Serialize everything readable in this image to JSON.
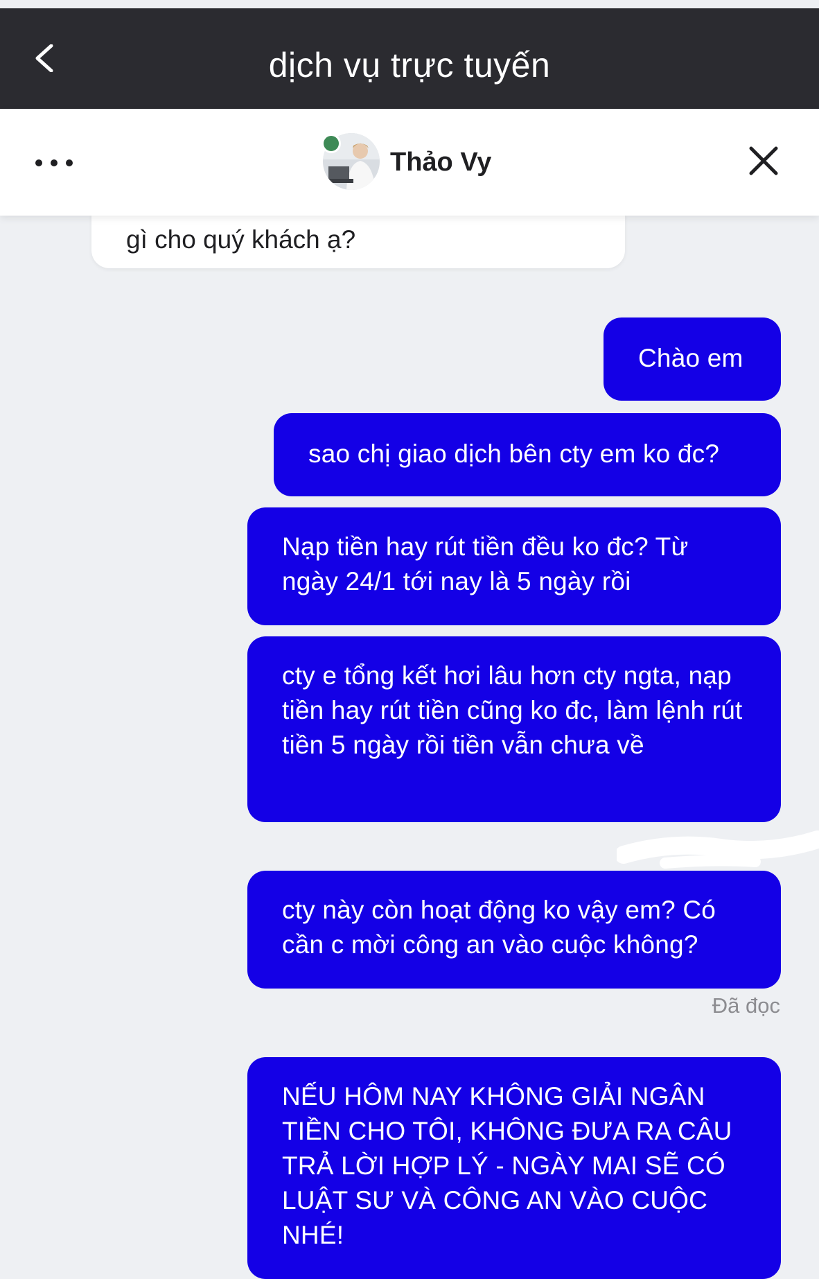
{
  "header": {
    "title": "dịch vụ trực tuyến"
  },
  "chat": {
    "agent_name": "Thảo Vy",
    "status_color": "#3e8a56"
  },
  "messages": {
    "incoming_partial": "gì cho quý khách ạ?",
    "outgoing": [
      "Chào em",
      "sao chị giao dịch bên cty em ko đc?",
      "Nạp tiền hay rút tiền đều ko đc? Từ ngày 24/1 tới nay là 5 ngày rồi",
      "cty e tổng kết hơi lâu hơn cty ngta, nạp tiền hay rút tiền cũng ko đc, làm lệnh rút tiền 5 ngày rồi tiền vẫn chưa về",
      "cty này còn hoạt động ko vậy em? Có cần c mời công an vào cuộc không?",
      "NẾU HÔM NAY KHÔNG GIẢI NGÂN TIỀN CHO TÔI, KHÔNG ĐƯA RA CÂU TRẢ LỜI HỢP LÝ - NGÀY MAI SẼ CÓ LUẬT SƯ VÀ CÔNG AN VÀO CUỘC NHÉ!"
    ],
    "read_receipt": "Đã đọc"
  },
  "colors": {
    "header_bg": "#2b2b30",
    "outgoing_bubble": "#1400e6",
    "incoming_bubble": "#ffffff",
    "chat_bg": "#eef0f3"
  },
  "icons": [
    "back-chevron-icon",
    "more-dots-icon",
    "close-icon"
  ]
}
